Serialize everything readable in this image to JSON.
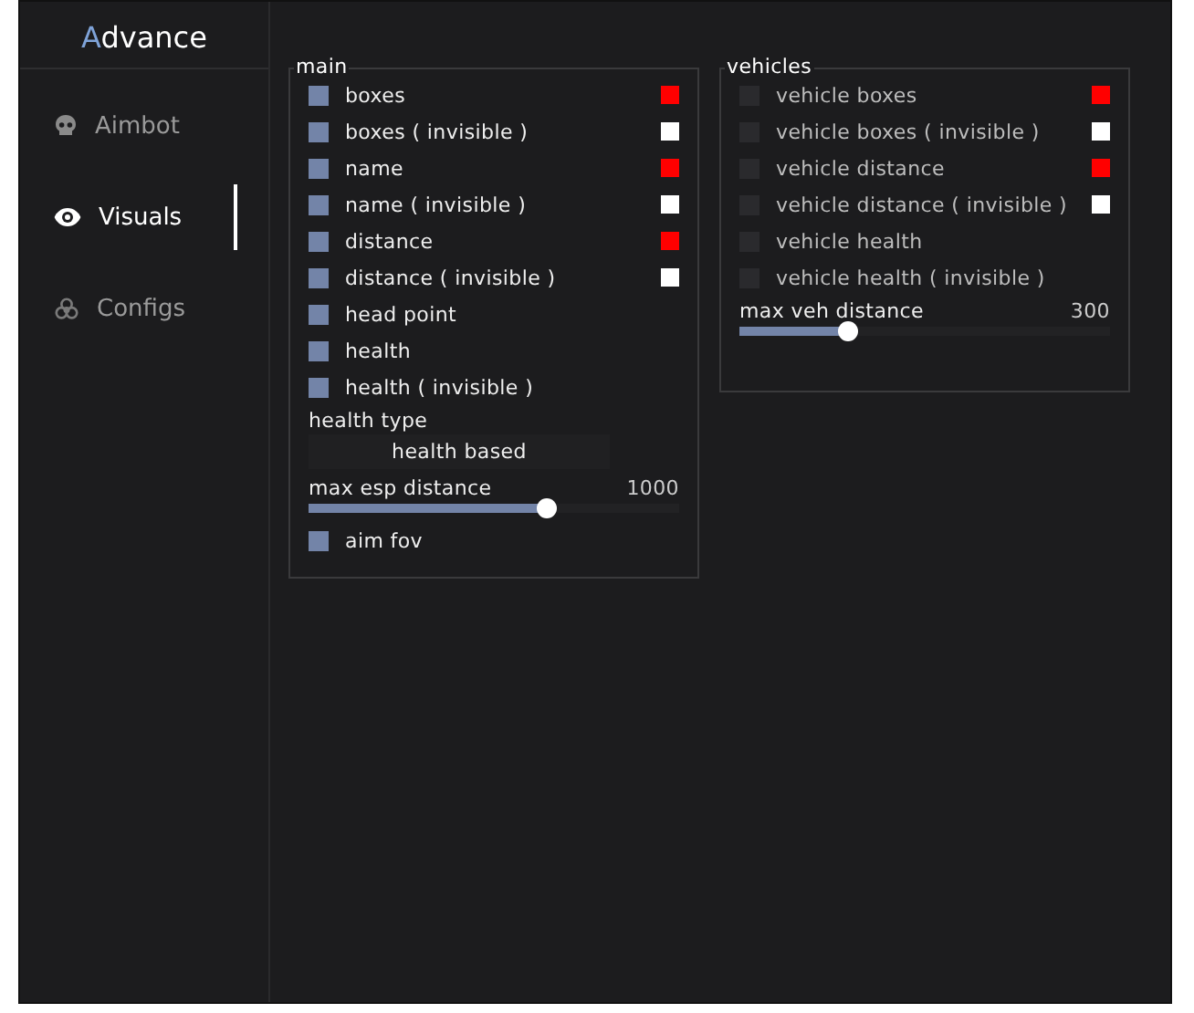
{
  "window": {
    "title": "Advance"
  },
  "sidebar": {
    "items": [
      {
        "label": "Aimbot",
        "selected": false
      },
      {
        "label": "Visuals",
        "selected": true
      },
      {
        "label": "Configs",
        "selected": false
      }
    ]
  },
  "panels": [
    {
      "title": "main",
      "items": [
        {
          "kind": "checkbox",
          "label": "boxes",
          "checked": true,
          "color": "#ff0000"
        },
        {
          "kind": "checkbox",
          "label": "boxes ( invisible )",
          "checked": true,
          "color": "#ffffff"
        },
        {
          "kind": "checkbox",
          "label": "name",
          "checked": true,
          "color": "#ff0000"
        },
        {
          "kind": "checkbox",
          "label": "name ( invisible )",
          "checked": true,
          "color": "#ffffff"
        },
        {
          "kind": "checkbox",
          "label": "distance",
          "checked": true,
          "color": "#ff0000"
        },
        {
          "kind": "checkbox",
          "label": "distance ( invisible )",
          "checked": true,
          "color": "#ffffff"
        },
        {
          "kind": "checkbox",
          "label": "head point",
          "checked": true
        },
        {
          "kind": "checkbox",
          "label": "health",
          "checked": true
        },
        {
          "kind": "checkbox",
          "label": "health ( invisible )",
          "checked": true
        },
        {
          "kind": "label",
          "label": "health type"
        },
        {
          "kind": "dropdown",
          "value": "health based"
        },
        {
          "kind": "slider",
          "label": "max esp distance",
          "reading": "1000",
          "level": 0.64
        },
        {
          "kind": "checkbox",
          "label": "aim fov",
          "checked": true
        }
      ]
    },
    {
      "title": "vehicles",
      "items": [
        {
          "kind": "checkbox",
          "label": "vehicle boxes",
          "checked": false,
          "color": "#ff0000"
        },
        {
          "kind": "checkbox",
          "label": "vehicle boxes ( invisible )",
          "checked": false,
          "color": "#ffffff"
        },
        {
          "kind": "checkbox",
          "label": "vehicle distance",
          "checked": false,
          "color": "#ff0000"
        },
        {
          "kind": "checkbox",
          "label": "vehicle distance ( invisible )",
          "checked": false,
          "color": "#ffffff"
        },
        {
          "kind": "checkbox",
          "label": "vehicle health",
          "checked": false
        },
        {
          "kind": "checkbox",
          "label": "vehicle health ( invisible )",
          "checked": false
        },
        {
          "kind": "slider",
          "label": "max veh distance",
          "reading": "300",
          "level": 0.29
        }
      ]
    }
  ]
}
